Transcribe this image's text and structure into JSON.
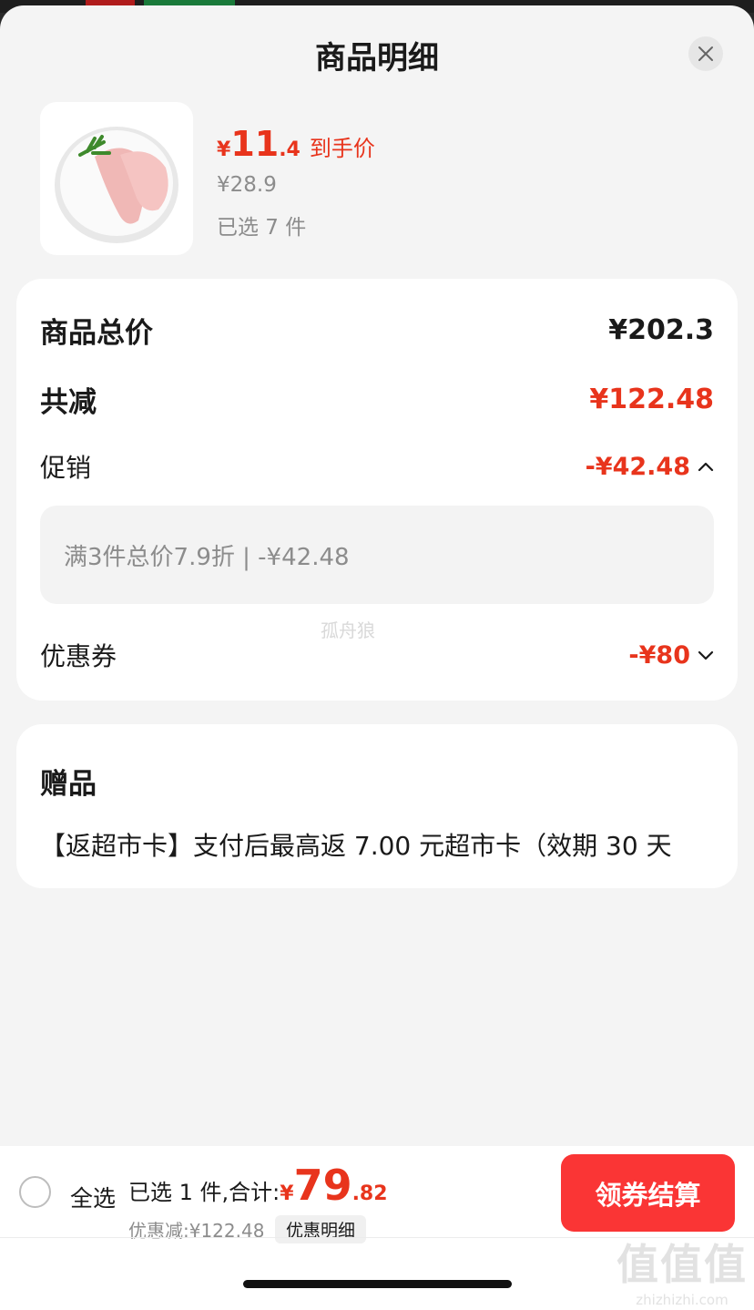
{
  "header": {
    "title": "商品明细"
  },
  "product": {
    "price_currency": "¥",
    "price_int": "11",
    "price_dec": ".4",
    "price_label": "到手价",
    "original_price": "¥28.9",
    "selected_count": "已选 7 件"
  },
  "summary": {
    "total_label": "商品总价",
    "total_value": "¥202.3",
    "reduction_label": "共减",
    "reduction_value": "¥122.48",
    "promo_label": "促销",
    "promo_value": "-¥42.48",
    "promo_detail": "满3件总价7.9折 | -¥42.48",
    "coupon_label": "优惠券",
    "coupon_value": "-¥80"
  },
  "watermark": "孤舟狼",
  "gift": {
    "title": "赠品",
    "text": "【返超市卡】支付后最高返 7.00 元超市卡（效期 30 天"
  },
  "footer": {
    "select_all": "全选",
    "summary_text": "已选 1 件,合计:",
    "total_currency": "¥",
    "total_int": "79",
    "total_dec": ".82",
    "discount_text": "优惠减:¥122.48",
    "detail_button": "优惠明细",
    "checkout_button": "领券结算"
  },
  "brand_watermark": {
    "logo": "值值值",
    "url": "zhizhizhi.com"
  },
  "colors": {
    "accent": "#e8341c",
    "checkout": "#fa3535",
    "background": "#f4f4f4"
  }
}
